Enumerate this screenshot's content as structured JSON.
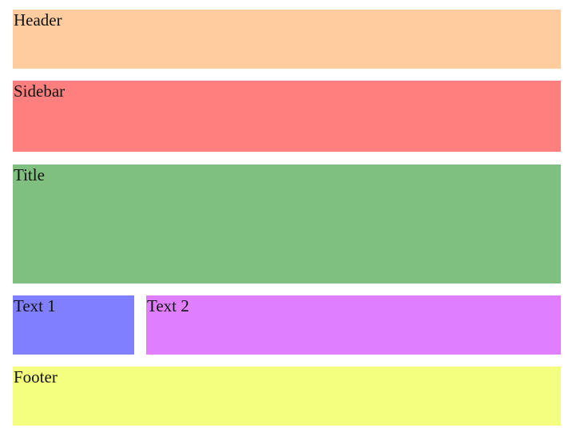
{
  "regions": {
    "header": {
      "label": "Header",
      "color": "#ffcc9f"
    },
    "sidebar": {
      "label": "Sidebar",
      "color": "#ff7f7f"
    },
    "title": {
      "label": "Title",
      "color": "#7fbf7f"
    },
    "text1": {
      "label": "Text 1",
      "color": "#7f7fff"
    },
    "text2": {
      "label": "Text 2",
      "color": "#df7fff"
    },
    "footer": {
      "label": "Footer",
      "color": "#f4ff80"
    }
  }
}
